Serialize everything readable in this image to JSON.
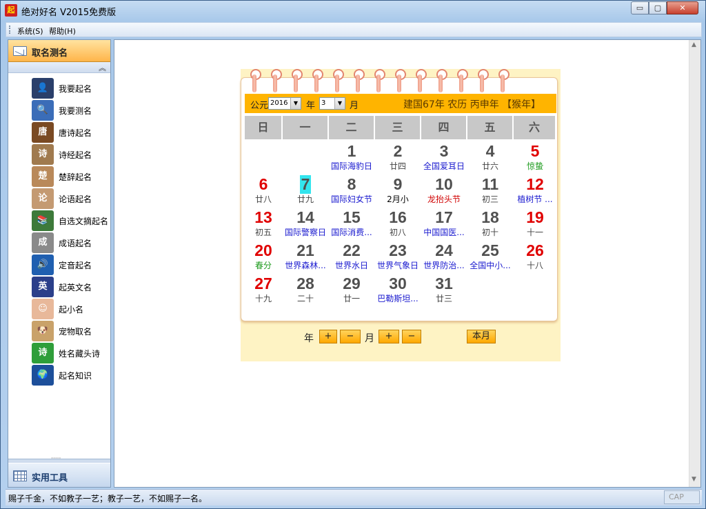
{
  "window": {
    "app_icon": "起",
    "title": "绝对好名 V2015免费版",
    "min_glyph": "▭",
    "max_glyph": "▢",
    "close_glyph": "✕"
  },
  "menu": [
    "系统(S)",
    "帮助(H)"
  ],
  "sidebar": {
    "header": "取名测名",
    "collapse_glyph": "︽",
    "items": [
      {
        "label": "我要起名",
        "icon": "businessman-icon",
        "color": "#2a3f6b",
        "glyph": "👤"
      },
      {
        "label": "我要测名",
        "icon": "magnifier-icon",
        "color": "#3b6db8",
        "glyph": "🔍"
      },
      {
        "label": "唐诗起名",
        "icon": "tang-poem-icon",
        "color": "#7a4a23",
        "glyph": "唐"
      },
      {
        "label": "诗经起名",
        "icon": "shijing-scroll-icon",
        "color": "#a07a4e",
        "glyph": "诗"
      },
      {
        "label": "楚辞起名",
        "icon": "chuci-scroll-icon",
        "color": "#b9895a",
        "glyph": "楚"
      },
      {
        "label": "论语起名",
        "icon": "lunyu-scroll-icon",
        "color": "#c49a72",
        "glyph": "论"
      },
      {
        "label": "自选文摘起名",
        "icon": "books-icon",
        "color": "#3d7a3a",
        "glyph": "📚"
      },
      {
        "label": "成语起名",
        "icon": "idiom-scroll-icon",
        "color": "#8a8a8a",
        "glyph": "成"
      },
      {
        "label": "定音起名",
        "icon": "speaker-icon",
        "color": "#1f5fb0",
        "glyph": "🔊"
      },
      {
        "label": "起英文名",
        "icon": "uk-flag-icon",
        "color": "#2b3f8a",
        "glyph": "英"
      },
      {
        "label": "起小名",
        "icon": "baby-icon",
        "color": "#e8b89a",
        "glyph": "☺"
      },
      {
        "label": "宠物取名",
        "icon": "dog-icon",
        "color": "#c9a26a",
        "glyph": "🐶"
      },
      {
        "label": "姓名藏头诗",
        "icon": "poem-icon",
        "color": "#2f9e3a",
        "glyph": "诗"
      },
      {
        "label": "起名知识",
        "icon": "globe-icon",
        "color": "#1d4f9a",
        "glyph": "🌍"
      }
    ],
    "tools_label": "实用工具",
    "splitter_glyph": "·····"
  },
  "calendar": {
    "gongyuan_label": "公元",
    "year_value": "2016",
    "year_label": "年",
    "month_value": "3",
    "month_label": "月",
    "select_arrow": "▼",
    "lunar_info": "建国67年  农历  丙申年  【猴年】",
    "weekdays": [
      "日",
      "一",
      "二",
      "三",
      "四",
      "五",
      "六"
    ],
    "weeks": [
      [
        null,
        null,
        {
          "day": "1",
          "sub": "国际海豹日",
          "kind": "fest"
        },
        {
          "day": "2",
          "sub": "廿四",
          "kind": "lunar"
        },
        {
          "day": "3",
          "sub": "全国爱耳日",
          "kind": "fest"
        },
        {
          "day": "4",
          "sub": "廿六",
          "kind": "lunar"
        },
        {
          "day": "5",
          "sub": "惊蛰",
          "kind": "term",
          "red": true
        }
      ],
      [
        {
          "day": "6",
          "sub": "廿八",
          "kind": "lunar",
          "red": true
        },
        {
          "day": "7",
          "sub": "廿九",
          "kind": "lunar",
          "today": true
        },
        {
          "day": "8",
          "sub": "国际妇女节",
          "kind": "fest"
        },
        {
          "day": "9",
          "sub": "2月小",
          "kind": "blk"
        },
        {
          "day": "10",
          "sub": "龙抬头节",
          "kind": "redfest"
        },
        {
          "day": "11",
          "sub": "初三",
          "kind": "lunar"
        },
        {
          "day": "12",
          "sub": "植树节 ...",
          "kind": "fest",
          "red": true
        }
      ],
      [
        {
          "day": "13",
          "sub": "初五",
          "kind": "lunar",
          "red": true
        },
        {
          "day": "14",
          "sub": "国际警察日",
          "kind": "fest"
        },
        {
          "day": "15",
          "sub": "国际消费...",
          "kind": "fest"
        },
        {
          "day": "16",
          "sub": "初八",
          "kind": "lunar"
        },
        {
          "day": "17",
          "sub": "中国国医...",
          "kind": "fest"
        },
        {
          "day": "18",
          "sub": "初十",
          "kind": "lunar"
        },
        {
          "day": "19",
          "sub": "十一",
          "kind": "lunar",
          "red": true
        }
      ],
      [
        {
          "day": "20",
          "sub": "春分",
          "kind": "term",
          "red": true
        },
        {
          "day": "21",
          "sub": "世界森林...",
          "kind": "fest"
        },
        {
          "day": "22",
          "sub": "世界水日",
          "kind": "fest"
        },
        {
          "day": "23",
          "sub": "世界气象日",
          "kind": "fest"
        },
        {
          "day": "24",
          "sub": "世界防治...",
          "kind": "fest"
        },
        {
          "day": "25",
          "sub": "全国中小...",
          "kind": "fest"
        },
        {
          "day": "26",
          "sub": "十八",
          "kind": "lunar",
          "red": true
        }
      ],
      [
        {
          "day": "27",
          "sub": "十九",
          "kind": "lunar",
          "red": true
        },
        {
          "day": "28",
          "sub": "二十",
          "kind": "lunar"
        },
        {
          "day": "29",
          "sub": "廿一",
          "kind": "lunar"
        },
        {
          "day": "30",
          "sub": "巴勒斯坦...",
          "kind": "fest"
        },
        {
          "day": "31",
          "sub": "廿三",
          "kind": "lunar"
        },
        null,
        null
      ]
    ],
    "bottom": {
      "year_label": "年",
      "month_label": "月",
      "plus": "+",
      "minus": "−",
      "this_month": "本月"
    }
  },
  "scrollbar": {
    "up": "▲",
    "down": "▼"
  },
  "status": {
    "text": "赐子千金，不如教子一艺；教子一艺，不如赐子一名。",
    "cap": "CAP"
  }
}
